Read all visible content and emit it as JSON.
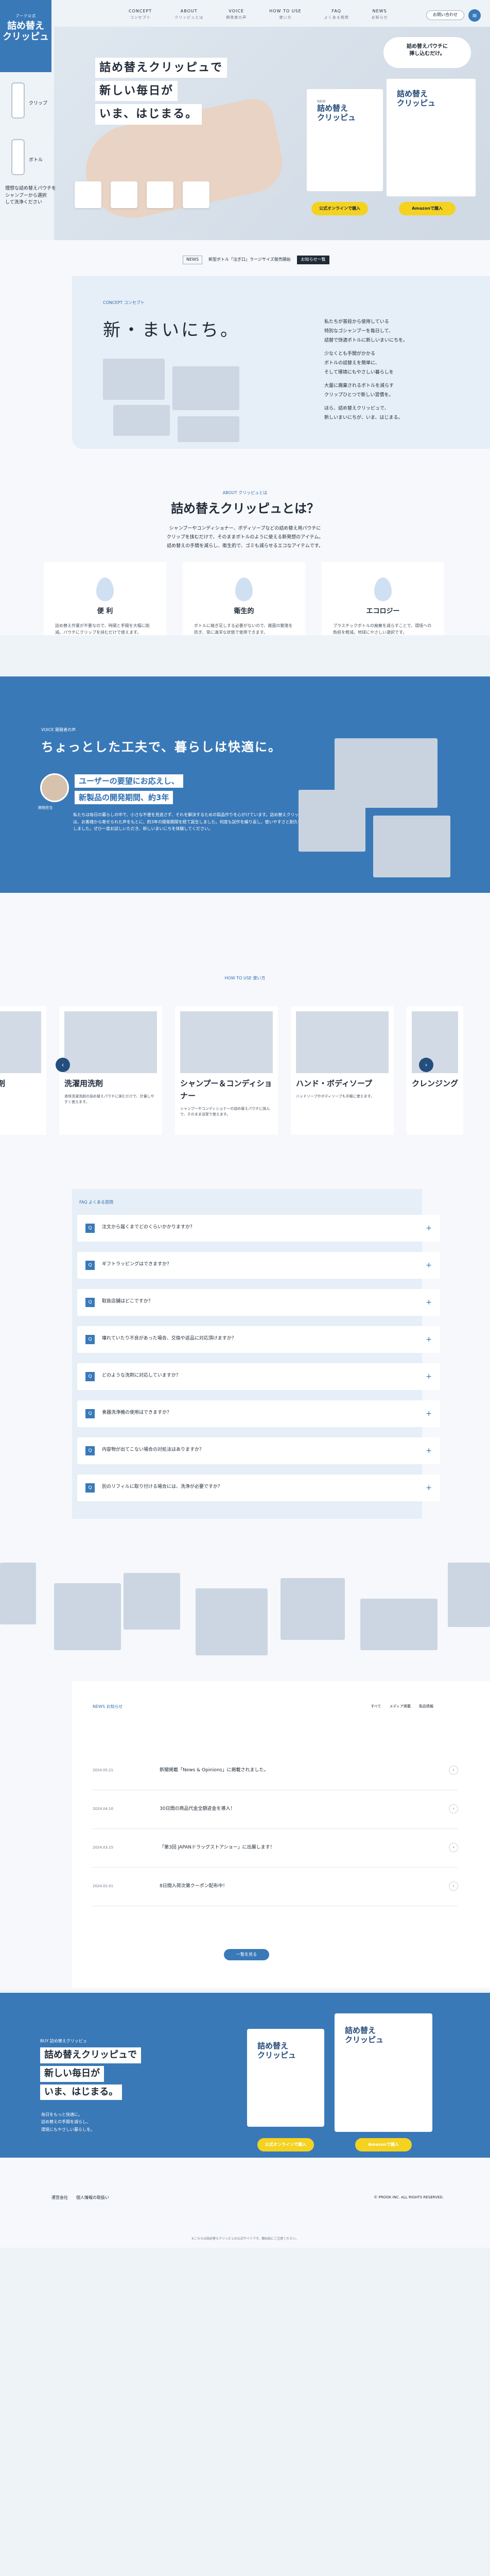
{
  "brand": {
    "tag": "プーク公式",
    "name_line1": "詰め替え",
    "name_line2": "クリッピュ"
  },
  "side": {
    "prod1": "クリップ",
    "prod2": "ボトル",
    "foot1": "理想な詰め替えパウチを",
    "foot2": "シャンプーから選択",
    "foot3": "して洗浄ください"
  },
  "nav": [
    {
      "en": "CONCEPT",
      "jp": "コンセプト"
    },
    {
      "en": "ABOUT",
      "jp": "クリッピュとは"
    },
    {
      "en": "VOICE",
      "jp": "開発者の声"
    },
    {
      "en": "HOW TO USE",
      "jp": "使い方"
    },
    {
      "en": "FAQ",
      "jp": "よくある質問"
    },
    {
      "en": "NEWS",
      "jp": "お知らせ"
    }
  ],
  "header": {
    "contact": "お問い合わせ",
    "menu_icon": "≡"
  },
  "hero": {
    "line1": "詰め替えクリッピュで",
    "line2": "新しい毎日が",
    "line3": "いま、はじまる。",
    "bubble1": "詰め替えパウチに",
    "bubble2": "挿し込むだけ。",
    "box_brand": "NEW",
    "box_title1": "詰め替え",
    "box_title2": "クリッピュ",
    "buy1": "公式オンラインで購入",
    "buy2": "Amazonで購入"
  },
  "notice": {
    "date": "NEWS",
    "text": "新型ボトル「注ぎ口」ラージサイズ発売開始",
    "btn": "お知らせ一覧"
  },
  "concept": {
    "label": "CONCEPT コンセプト",
    "title": "新・まいにち。",
    "text": [
      "私たちが普段から使用している",
      "特別なゴシャンプーを毎日して、",
      "詰替で快適ボトルに新しいまいにちを。",
      "",
      "少なくとも手間がかかる",
      "ボトルの詰替えを簡単に、",
      "そして環境にもやさしい暮らしを",
      "",
      "大量に廃棄されるボトルを減らす",
      "クリップひとつで新しい習慣を。",
      "",
      "ほら、詰め替えクリッピュで、",
      "新しいまいにちが、いま、はじまる。"
    ]
  },
  "about": {
    "label": "ABOUT クリッピュとは",
    "title": "詰め替えクリッピュとは？",
    "lead1": "シャンプーやコンディショナー、ボディソープなどの詰め替え用パウチに",
    "lead2": "クリップを挟むだけで、そのままボトルのように使える新発想のアイテム。",
    "lead3": "詰め替えの手間を減らし、衛生的で、ゴミも減らせるエコなアイテムです。",
    "features": [
      {
        "title": "便 利",
        "desc": "詰め替え作業が不要なので、時間と手間を大幅に削減。パウチにクリップを挟むだけで使えます。"
      },
      {
        "title": "衛生的",
        "desc": "ボトルに継ぎ足しする必要がないので、雑菌の繁殖を防ぎ、常に清潔な状態で使用できます。"
      },
      {
        "title": "エコロジー",
        "desc": "プラスチックボトルの廃棄を減らすことで、環境への負担を軽減。地球にやさしい選択です。"
      }
    ]
  },
  "voice": {
    "label": "VOICE 開発者の声",
    "title": "ちょっとした工夫で、暮らしは快適に。",
    "bubble1": "ユーザーの要望にお応えし、",
    "bubble2": "新製品の開発期間、約3年",
    "person": "開発担当",
    "body": "私たちは毎日の暮らしの中で、小さな不便を見逃さず、それを解決するための製品作りを心がけています。詰め替えクリッピュは、お客様から寄せられた声をもとに、約3年の開発期間を経て誕生しました。何度も試作を繰り返し、使いやすさと耐久性を追求しました。ぜひ一度お試しいただき、新しいまいにちを体験してください。"
  },
  "howto": {
    "label": "HOW TO USE 使い方",
    "cards": [
      {
        "title": "洗剤",
        "desc": "洗濯洗剤の詰め替えパウチにも使用できます。"
      },
      {
        "title": "洗濯用洗剤",
        "desc": "液体洗濯洗剤の詰め替えパウチに挟むだけで、計量しやすく使えます。"
      },
      {
        "title": "シャンプー＆コンディショナー",
        "desc": "シャンプーやコンディショナーの詰め替えパウチに挟んで、そのまま浴室で使えます。"
      },
      {
        "title": "ハンド・ボディソープ",
        "desc": "ハンドソープやボディソープも手軽に使えます。"
      },
      {
        "title": "クレンジング",
        "desc": "クレンジングオイルのパウチにも対応しています。"
      }
    ],
    "prev": "‹",
    "next": "›"
  },
  "faq": {
    "label": "FAQ よくある質問",
    "items": [
      "注文から届くまでどのくらいかかりますか？",
      "ギフトラッピングはできますか？",
      "取扱店舗はどこですか？",
      "壊れていたり不良があった場合、交換や返品に対応頂けますか？",
      "どのような洗剤に対応していますか？",
      "食器洗浄機の使用はできますか？",
      "内容物が出てこない場合の対処法はありますか？",
      "別のリフィルに取り付ける場合には、洗浄が必要ですか？"
    ],
    "q": "Q",
    "plus": "+"
  },
  "news": {
    "label": "NEWS お知らせ",
    "tabs": [
      "すべて",
      "メディア掲載",
      "製品情報"
    ],
    "items": [
      {
        "date": "2024.05.21",
        "title": "新聞掲載「News & Opinions」に掲載されました。"
      },
      {
        "date": "2024.04.10",
        "title": "30日間の商品代金全額返金を導入！"
      },
      {
        "date": "2024.03.15",
        "title": "「第3回 JAPANドラッグストアショー」に出展します！"
      },
      {
        "date": "2024.02.01",
        "title": "8日間入荷次第クーポン配布中！"
      }
    ],
    "arrow": "›",
    "list_btn": "一覧を見る"
  },
  "cta": {
    "label": "BUY 詰め替えクリッピュ",
    "line1": "詰め替えクリッピュで",
    "line2": "新しい毎日が",
    "line3": "いま、はじまる。",
    "text1": "毎日をもっと快適に。",
    "text2": "詰め替えの手間を減らし、",
    "text3": "環境にもやさしい暮らしを。",
    "buy1": "公式オンラインで購入",
    "buy2": "Amazonで購入",
    "box_title1": "詰め替え",
    "box_title2": "クリッピュ"
  },
  "footer": {
    "links": [
      "運営会社",
      "個人情報の取扱い"
    ],
    "copy": "© PROOK INC. ALL RIGHTS RESERVED.",
    "note": "※こちらは詰め替えクリッピュの公式サイトです。類似品にご注意ください。"
  },
  "colors": {
    "primary": "#3a79b8",
    "accent": "#f4d21f",
    "bg": "#eef3f8"
  }
}
